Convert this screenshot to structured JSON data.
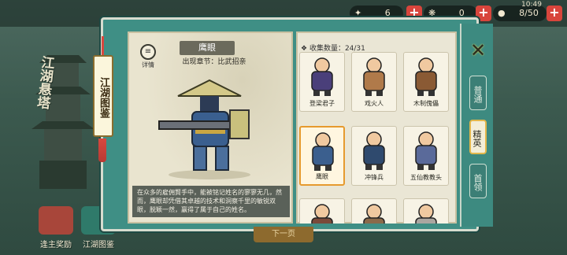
{
  "topbar": {
    "resources": [
      {
        "icon": "coin-icon",
        "value": "6"
      },
      {
        "icon": "scroll-icon",
        "value": "0"
      },
      {
        "icon": "peach-icon",
        "value": "8/50"
      }
    ],
    "time": "10:49"
  },
  "background": {
    "vertical_title": "江湖悬塔",
    "bottom_buttons": [
      {
        "label": "逢主奖励",
        "icon": "reward-chest-icon"
      },
      {
        "label": "江湖图鉴",
        "icon": "book-icon"
      }
    ]
  },
  "bookmark": {
    "label": "江湖图鉴"
  },
  "detail": {
    "button_label": "详情",
    "name": "鹰眼",
    "chapter": "出现章节：比武招亲",
    "description": "在众多的雇佣賢手中，能被铭记姓名的寥寥无几，然而，鹰眼却凭借其卓越的技术和洞察千里的敏锐双眼，脱颖一然，赢得了属于自己的姓名。"
  },
  "collection": {
    "label": "收集数量：24/31",
    "cards": [
      {
        "name": "登梁君子",
        "selected": false,
        "color": "#4a3f7a"
      },
      {
        "name": "戏火人",
        "selected": false,
        "color": "#b07a4a"
      },
      {
        "name": "木制傀儡",
        "selected": false,
        "color": "#8a5a34"
      },
      {
        "name": "鹰眼",
        "selected": true,
        "color": "#3b5f8e"
      },
      {
        "name": "冲锋兵",
        "selected": false,
        "color": "#2f4a6e"
      },
      {
        "name": "五仙教教头",
        "selected": false,
        "color": "#5a6a9a"
      },
      {
        "name": "",
        "selected": false,
        "color": "#7a4a3a"
      },
      {
        "name": "",
        "selected": false,
        "color": "#8a6a4a"
      },
      {
        "name": "",
        "selected": false,
        "color": "#aaa6a0"
      }
    ]
  },
  "tabs": [
    {
      "label": "普通",
      "active": false
    },
    {
      "label": "精英",
      "active": true
    },
    {
      "label": "首领",
      "active": false
    }
  ],
  "bottom_tab": "下一页"
}
